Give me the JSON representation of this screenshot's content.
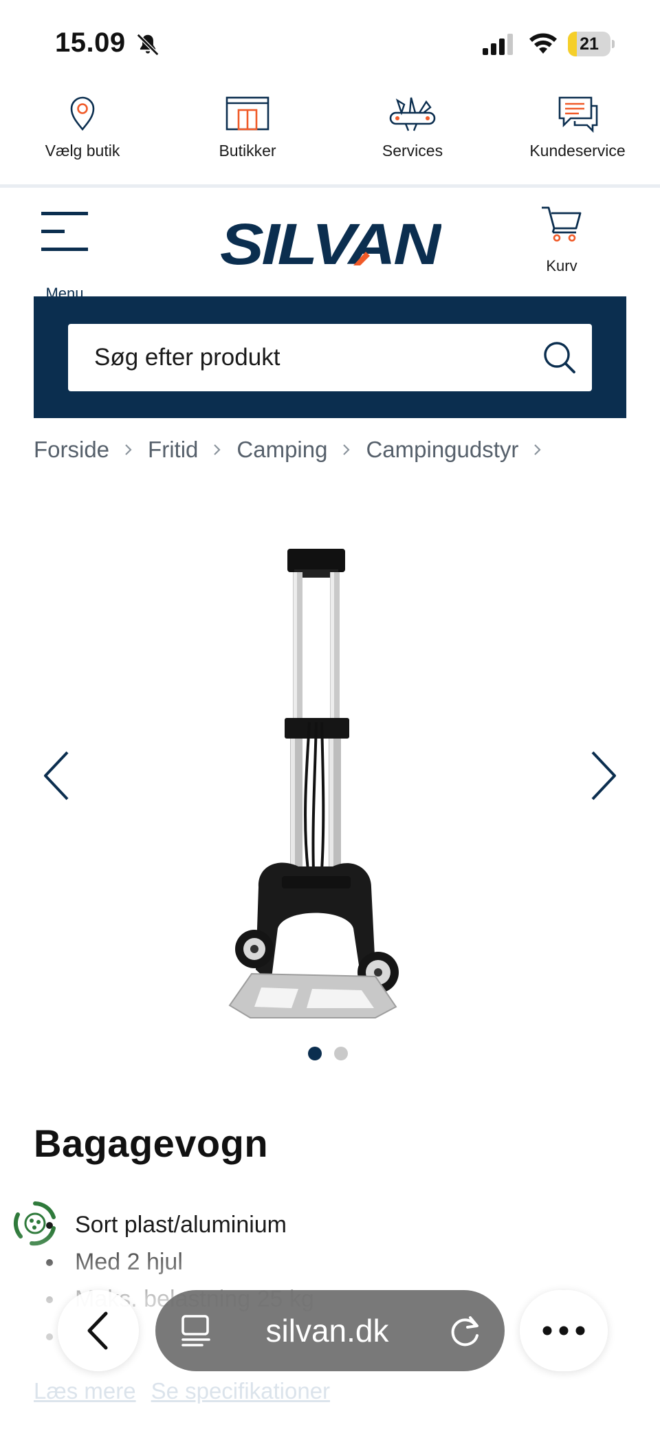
{
  "status_bar": {
    "time": "15.09",
    "battery_level": "21",
    "battery_fraction": 0.21,
    "icons": [
      "bell-slash-icon",
      "cellular-signal-icon",
      "wifi-icon",
      "battery-icon"
    ]
  },
  "utility_nav": {
    "items": [
      {
        "label": "Vælg butik",
        "icon": "location-pin-icon"
      },
      {
        "label": "Butikker",
        "icon": "store-icon"
      },
      {
        "label": "Services",
        "icon": "multitool-icon"
      },
      {
        "label": "Kundeservice",
        "icon": "chat-bubbles-icon"
      }
    ]
  },
  "header": {
    "menu_label": "Menu",
    "logo_text": "SILVAN",
    "cart_label": "Kurv"
  },
  "search": {
    "placeholder": "Søg efter produkt"
  },
  "breadcrumb": {
    "items": [
      "Forside",
      "Fritid",
      "Camping",
      "Campingudstyr"
    ]
  },
  "gallery": {
    "image_count": 2,
    "active_index": 0,
    "image_subject": "folding-hand-truck"
  },
  "product": {
    "title": "Bagagevogn",
    "features": [
      "Sort plast/aluminium",
      "Med 2 hjul",
      "Maks. belastning 25 kg",
      ""
    ],
    "links": {
      "read_more": "Læs mere",
      "specifications": "Se specifikationer"
    }
  },
  "browser": {
    "url": "silvan.dk",
    "icons": [
      "back-chevron-icon",
      "reader-icon",
      "reload-icon",
      "more-dots-icon"
    ]
  },
  "colors": {
    "brand_navy": "#0b2e4f",
    "brand_orange": "#f05a28",
    "battery_yellow": "#f5cf2a"
  }
}
